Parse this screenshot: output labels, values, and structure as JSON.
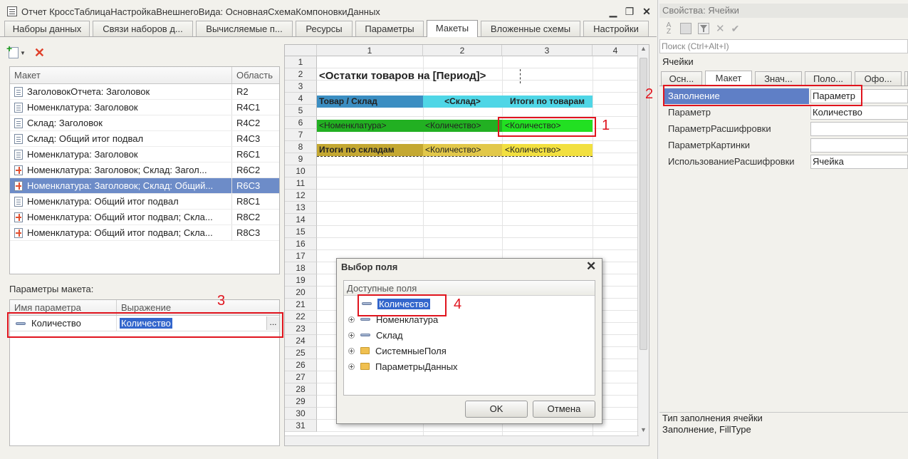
{
  "window": {
    "title": "Отчет КроссТаблицаНастройкаВнешнегоВида: ОсновнаяСхемаКомпоновкиДанных"
  },
  "tabs": [
    "Наборы данных",
    "Связи наборов д...",
    "Вычисляемые п...",
    "Ресурсы",
    "Параметры",
    "Макеты",
    "Вложенные схемы",
    "Настройки"
  ],
  "layouts": {
    "headers": {
      "name": "Макет",
      "area": "Область"
    },
    "rows": [
      {
        "name": "ЗаголовокОтчета: Заголовок",
        "area": "R2",
        "icon": "document-icon"
      },
      {
        "name": "Номенклатура: Заголовок",
        "area": "R4C1",
        "icon": "document-icon"
      },
      {
        "name": "Склад: Заголовок",
        "area": "R4C2",
        "icon": "document-icon"
      },
      {
        "name": "Склад: Общий итог подвал",
        "area": "R4C3",
        "icon": "document-icon"
      },
      {
        "name": "Номенклатура: Заголовок",
        "area": "R6C1",
        "icon": "document-icon"
      },
      {
        "name": "Номенклатура: Заголовок; Склад: Загол...",
        "area": "R6C2",
        "icon": "cross-table-icon"
      },
      {
        "name": "Номенклатура: Заголовок; Склад: Общий...",
        "area": "R6C3",
        "icon": "cross-table-icon"
      },
      {
        "name": "Номенклатура: Общий итог подвал",
        "area": "R8C1",
        "icon": "document-icon"
      },
      {
        "name": "Номенклатура: Общий итог подвал; Скла...",
        "area": "R8C2",
        "icon": "cross-table-icon"
      },
      {
        "name": "Номенклатура: Общий итог подвал; Скла...",
        "area": "R8C3",
        "icon": "cross-table-icon"
      }
    ],
    "selected_index": 6
  },
  "params": {
    "section_label": "Параметры макета:",
    "headers": {
      "name": "Имя параметра",
      "expr": "Выражение"
    },
    "row": {
      "name": "Количество",
      "expr": "Количество"
    },
    "ellipsis": "..."
  },
  "sheet": {
    "columns": [
      "1",
      "2",
      "3",
      "4"
    ],
    "rows": [
      "1",
      "2",
      "3",
      "4",
      "5",
      "6",
      "7",
      "8",
      "9",
      "10",
      "11",
      "12",
      "13",
      "14",
      "15",
      "16",
      "17",
      "18",
      "19",
      "20",
      "21",
      "22",
      "23",
      "24",
      "25",
      "26",
      "27",
      "28",
      "29",
      "30",
      "31"
    ],
    "title": "<Остатки товаров на [Период]>",
    "r4": {
      "c1": "Товар / Склад",
      "c2": "<Склад>",
      "c3": "Итоги по товарам"
    },
    "r6": {
      "c1": "<Номенклатура>",
      "c2": "<Количество>",
      "c3": "<Количество>"
    },
    "r8": {
      "c1": "Итоги по складам",
      "c2": "<Количество>",
      "c3": "<Количество>"
    },
    "colors": {
      "r4c1": "#3b8ec2",
      "r4c2": "#4fd6e6",
      "r4c3": "#4fd6e6",
      "r6c1": "#22b022",
      "r6c2": "#22b022",
      "r6c3": "#22e022",
      "r8c1": "#c4a832",
      "r8c2": "#e2c84a",
      "r8c3": "#f2e040"
    }
  },
  "dialog": {
    "title": "Выбор поля",
    "list_header": "Доступные поля",
    "items": [
      "Количество",
      "Номенклатура",
      "Склад",
      "СистемныеПоля",
      "ПараметрыДанных"
    ],
    "ok": "OK",
    "cancel": "Отмена"
  },
  "props": {
    "title": "Свойства: Ячейки",
    "search_placeholder": "Поиск (Ctrl+Alt+I)",
    "object": "Ячейки",
    "tabs": [
      "Осн...",
      "Макет",
      "Знач...",
      "Поло...",
      "Офо..."
    ],
    "rows": [
      {
        "label": "Заполнение",
        "value": "Параметр"
      },
      {
        "label": "Параметр",
        "value": "Количество"
      },
      {
        "label": "ПараметрРасшифровки",
        "value": ""
      },
      {
        "label": "ПараметрКартинки",
        "value": ""
      },
      {
        "label": "ИспользованиеРасшифровки",
        "value": "Ячейка"
      }
    ],
    "description_title": "Тип заполнения ячейки",
    "description_text": "Заполнение, FillType"
  },
  "annotations": [
    "1",
    "2",
    "3",
    "4"
  ]
}
